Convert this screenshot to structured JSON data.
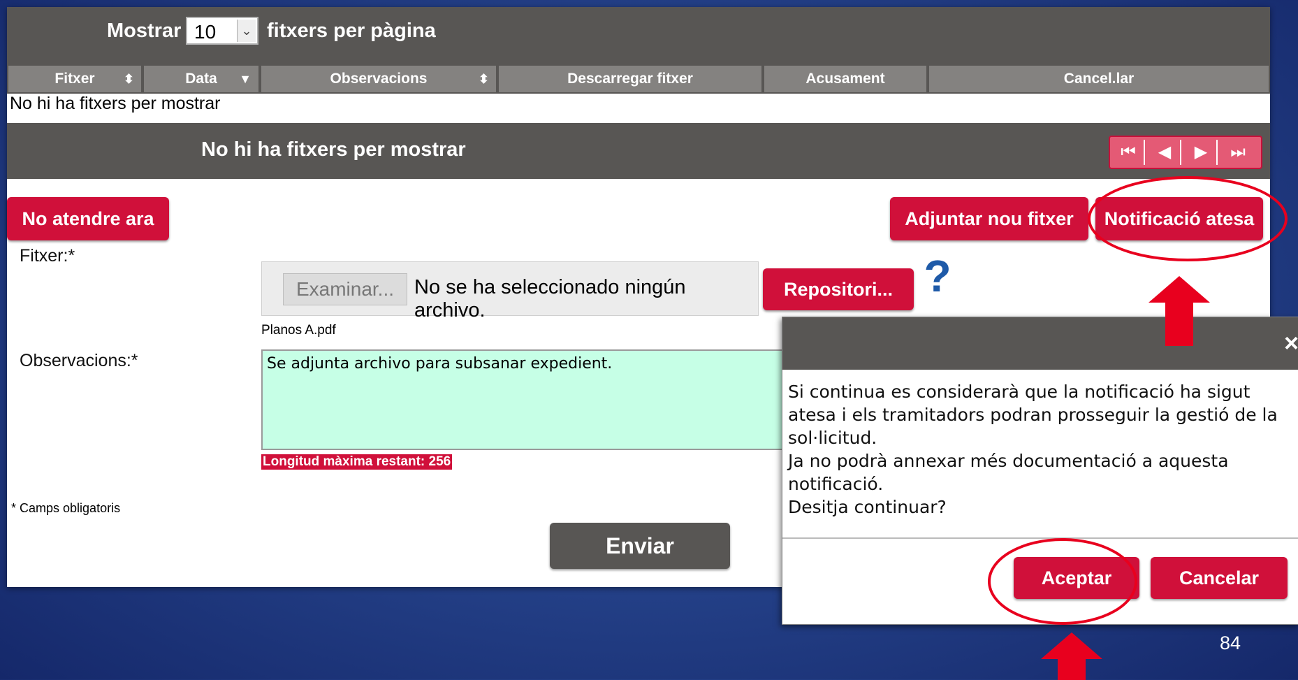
{
  "toolbar": {
    "show_label": "Mostrar",
    "page_size": "10",
    "per_page_label": "fitxers per pàgina"
  },
  "table": {
    "columns": [
      "Fitxer",
      "Data",
      "Observacions",
      "Descarregar fitxer",
      "Acusament",
      "Cancel.lar"
    ],
    "empty_message": "No hi ha fitxers per mostrar"
  },
  "footer": {
    "message": "No hi ha fitxers per mostrar",
    "pager_icons": [
      "first-page-icon",
      "prev-page-icon",
      "next-page-icon",
      "last-page-icon"
    ]
  },
  "actions": {
    "not_now": "No atendre ara",
    "attach_new": "Adjuntar nou fitxer",
    "notification_done": "Notificació atesa"
  },
  "form": {
    "file_label": "Fitxer:*",
    "browse": "Examinar...",
    "no_file": "No se ha seleccionado ningún archivo.",
    "repository": "Repositori...",
    "filename": "Planos A.pdf",
    "observations_label": "Observacions:*",
    "observations_value": "Se adjunta archivo para subsanar expedient.",
    "max_length": "Longitud màxima restant: 256",
    "required_note": "* Camps obligatoris",
    "send": "Enviar"
  },
  "dialog": {
    "close": "×",
    "lines": [
      "Si continua es considerarà que la notificació ha sigut",
      "atesa i els tramitadors podran prosseguir la gestió de la",
      "sol·licitud.",
      "Ja no podrà annexar més documentació a aquesta",
      "notificació.",
      "Desitja continuar?"
    ],
    "accept": "Aceptar",
    "cancel": "Cancelar"
  },
  "slide_number": "84",
  "colors": {
    "accent_red": "#d0103a",
    "bar_gray": "#585654",
    "textarea_bg": "#c6ffe6",
    "background_blue": "#233f86",
    "annotation_red": "#e8001e"
  }
}
